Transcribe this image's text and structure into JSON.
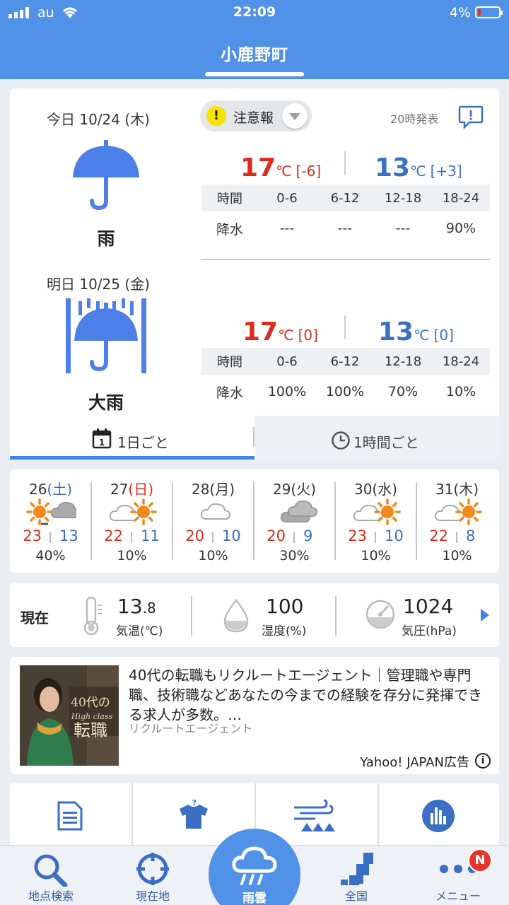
{
  "status_bar": {
    "carrier": "au",
    "time": "22:09",
    "battery": "4%"
  },
  "header": {
    "title": "小鹿野町"
  },
  "alert": {
    "label": "注意報",
    "issued": "20時発表"
  },
  "today": {
    "label": "今日 10/24 (木)",
    "weather": "雨",
    "high": "17",
    "high_unit": "℃",
    "high_diff": "[-6]",
    "low": "13",
    "low_unit": "℃",
    "low_diff": "[+3]",
    "table": {
      "head": [
        "時間",
        "0-6",
        "6-12",
        "12-18",
        "18-24"
      ],
      "row": [
        "降水",
        "---",
        "---",
        "---",
        "90%"
      ]
    }
  },
  "tomorrow": {
    "label": "明日 10/25 (金)",
    "weather": "大雨",
    "high": "17",
    "high_unit": "℃",
    "high_diff": "[0]",
    "low": "13",
    "low_unit": "℃",
    "low_diff": "[0]",
    "table": {
      "head": [
        "時間",
        "0-6",
        "6-12",
        "12-18",
        "18-24"
      ],
      "row": [
        "降水",
        "100%",
        "100%",
        "70%",
        "10%"
      ]
    }
  },
  "tabs": {
    "daily": "1日ごと",
    "hourly": "1時間ごと"
  },
  "weekly": [
    {
      "date_num": "26",
      "dow": "(土)",
      "dow_color": "#3a6fc4",
      "icon": "sun-then-cloud",
      "hi": "23",
      "lo": "13",
      "pop": "40%"
    },
    {
      "date_num": "27",
      "dow": "(日)",
      "dow_color": "#dd2a1b",
      "icon": "cloud-then-sun",
      "hi": "22",
      "lo": "11",
      "pop": "10%"
    },
    {
      "date_num": "28",
      "dow": "(月)",
      "dow_color": "#333333",
      "icon": "cloud",
      "hi": "20",
      "lo": "10",
      "pop": "10%"
    },
    {
      "date_num": "29",
      "dow": "(火)",
      "dow_color": "#333333",
      "icon": "clouds",
      "hi": "20",
      "lo": "9",
      "pop": "30%"
    },
    {
      "date_num": "30",
      "dow": "(水)",
      "dow_color": "#333333",
      "icon": "cloud-then-sun",
      "hi": "23",
      "lo": "10",
      "pop": "10%"
    },
    {
      "date_num": "31",
      "dow": "(木)",
      "dow_color": "#333333",
      "icon": "cloud-then-sun",
      "hi": "22",
      "lo": "8",
      "pop": "10%"
    }
  ],
  "current": {
    "label": "現在",
    "temp_int": "13",
    "temp_dec": ".8",
    "temp_caption": "気温(℃)",
    "humidity": "100",
    "humidity_caption": "湿度(%)",
    "pressure": "1024",
    "pressure_caption": "気圧(hPa)"
  },
  "ad": {
    "text": "40代の転職もリクルートエージェント｜管理職や専門職、技術職などあなたの今までの経験を存分に発揮できる求人が多数。…",
    "source": "リクルートエージェント",
    "brand": "Yahoo! JAPAN広告",
    "image_text_1": "40代の",
    "image_text_2": "High class",
    "image_text_3": "転職"
  },
  "tabbar": {
    "search": "地点検索",
    "location": "現在地",
    "rain": "雨雲",
    "nation": "全国",
    "menu": "メニュー",
    "menu_badge": "N"
  },
  "colors": {
    "primary": "#4f92e8",
    "high": "#dd2a1b",
    "low": "#3a6fc4",
    "sun": "#f08a1c"
  }
}
